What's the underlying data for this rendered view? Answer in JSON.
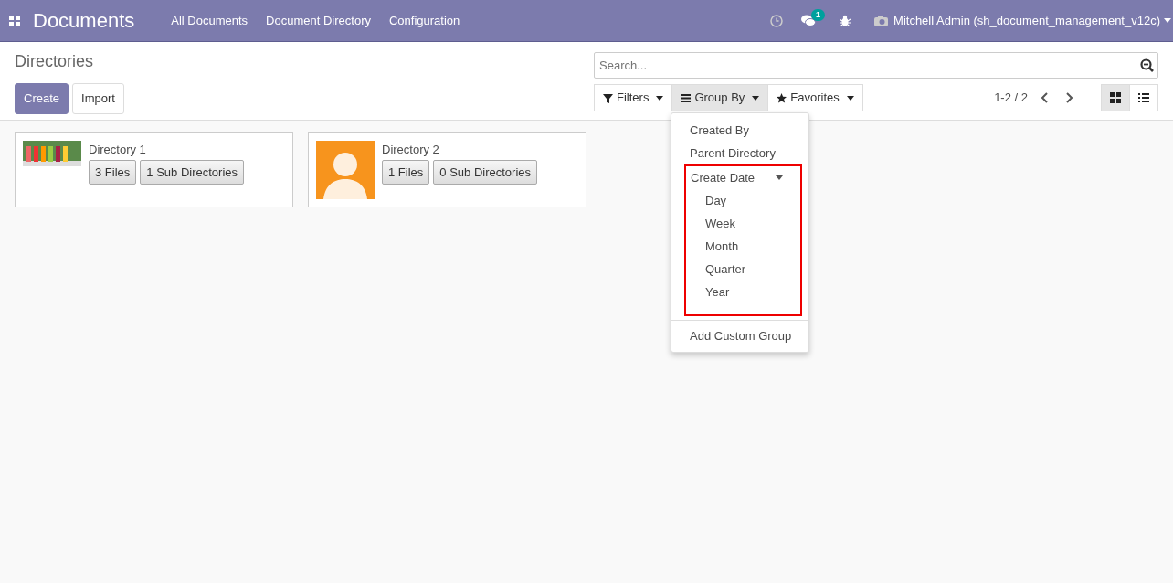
{
  "navbar": {
    "app_title": "Documents",
    "menu": [
      "All Documents",
      "Document Directory",
      "Configuration"
    ],
    "messages_badge": "1",
    "user": "Mitchell Admin (sh_document_management_v12c)"
  },
  "breadcrumb": "Directories",
  "buttons": [
    {
      "label": "Create",
      "kind": "primary"
    },
    {
      "label": "Import",
      "kind": "secondary"
    }
  ],
  "search": {
    "placeholder": "Search..."
  },
  "search_options": [
    {
      "label": "Filters",
      "kind": "filter",
      "open": false
    },
    {
      "label": "Group By",
      "kind": "bars",
      "open": true
    },
    {
      "label": "Favorites",
      "kind": "star",
      "open": false
    }
  ],
  "pager": "1-2 / 2",
  "views": [
    {
      "kind": "kanban",
      "selected": true
    },
    {
      "kind": "list",
      "selected": false
    }
  ],
  "group_by_menu": {
    "items": [
      {
        "label": "Created By"
      },
      {
        "label": "Parent Directory"
      },
      {
        "label": "Create Date",
        "expanded": true,
        "highlighted": true,
        "children": [
          {
            "label": "Day"
          },
          {
            "label": "Week"
          },
          {
            "label": "Month"
          },
          {
            "label": "Quarter"
          },
          {
            "label": "Year"
          }
        ]
      }
    ],
    "custom": "Add Custom Group"
  },
  "cards": [
    {
      "title": "Directory 1",
      "kind": "photo",
      "files": "3 Files",
      "subdirs": "1 Sub Directories"
    },
    {
      "title": "Directory 2",
      "kind": "avatar",
      "files": "1 Files",
      "subdirs": "0 Sub Directories"
    }
  ]
}
